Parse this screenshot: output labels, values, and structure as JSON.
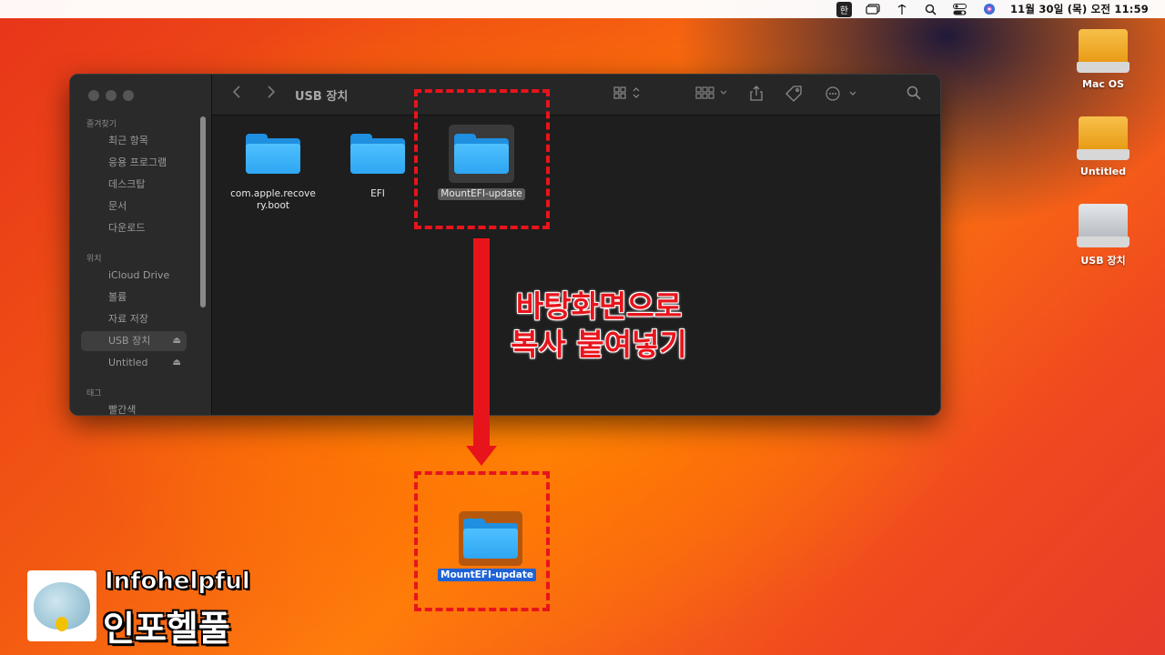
{
  "menubar": {
    "input_lang": "한",
    "icons": [
      "window-icon",
      "airdrop-icon",
      "search-icon",
      "control-center-icon",
      "siri-icon"
    ],
    "clock": "11월 30일 (목) 오전 11:59"
  },
  "finder": {
    "title": "USB 장치",
    "sidebar": {
      "sections": [
        {
          "label": "즐겨찾기",
          "items": [
            "최근 항목",
            "응용 프로그램",
            "데스크탑",
            "문서",
            "다운로드"
          ]
        },
        {
          "label": "위치",
          "items": [
            "iCloud Drive",
            "볼륨",
            "자료 저장",
            "USB 장치",
            "Untitled"
          ]
        },
        {
          "label": "태그",
          "items": [
            "빨간색"
          ]
        }
      ],
      "selected": "USB 장치"
    },
    "files": [
      {
        "name": "com.apple.recovery.boot",
        "line1": "com.apple.recove",
        "line2": "ry.boot"
      },
      {
        "name": "EFI"
      },
      {
        "name": "MountEFI-update"
      }
    ]
  },
  "annotation": {
    "line1": "바탕화면으로",
    "line2": "복사 붙여넣기",
    "color": "#e8141c"
  },
  "desktop_folder": {
    "name": "MountEFI-update"
  },
  "drives": [
    {
      "name": "Mac OS",
      "color": "#f2a81a"
    },
    {
      "name": "Untitled",
      "color": "#f2a81a"
    },
    {
      "name": "USB 장치",
      "color": "#c9cdd2"
    }
  ],
  "logo": {
    "en": "Infohelpful",
    "ko": "인포헬풀"
  }
}
